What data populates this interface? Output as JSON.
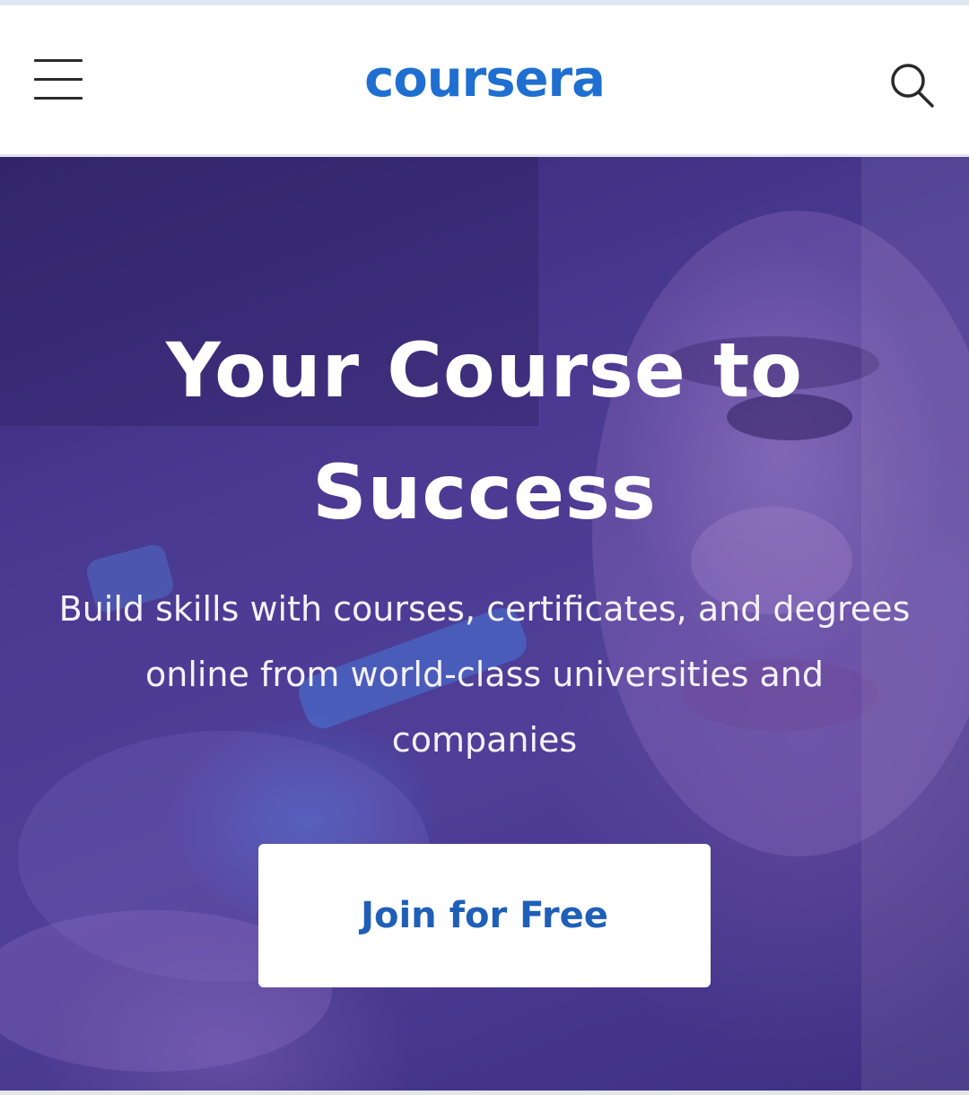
{
  "header": {
    "logo_text": "coursera",
    "menu_icon": "hamburger-menu-icon",
    "search_icon": "search-icon"
  },
  "hero": {
    "title_line1": "Your Course to",
    "title_line2": "Success",
    "subtitle_line1": "Build skills with courses, certificates, and degrees",
    "subtitle_line2": "online from world-class universities and",
    "subtitle_line3": "companies",
    "cta_label": "Join for Free"
  },
  "colors": {
    "brand_blue": "#1f6fd1",
    "hero_overlay": "#4a3a92",
    "cta_text": "#1f5fb8"
  }
}
